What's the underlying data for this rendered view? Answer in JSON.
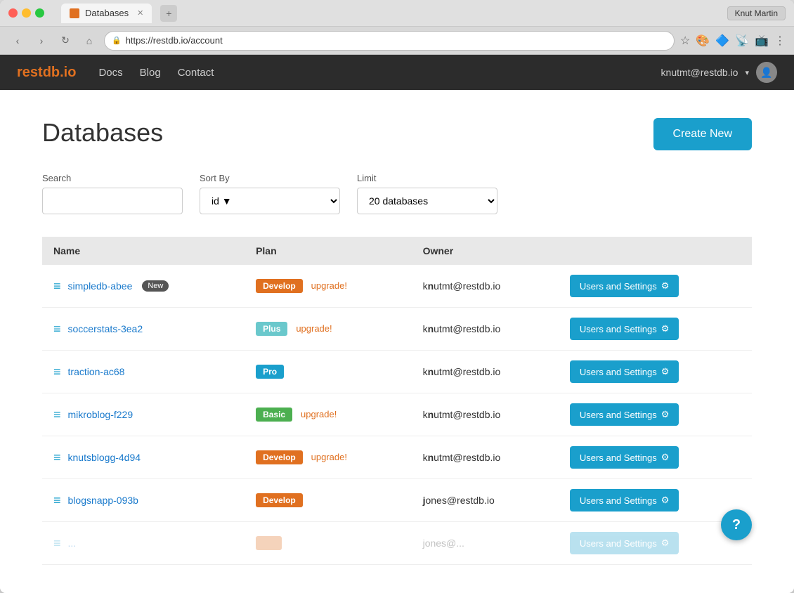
{
  "browser": {
    "tab_title": "Databases",
    "url": "https://restdb.io/account",
    "account_label": "Knut Martin",
    "nav_back": "‹",
    "nav_forward": "›",
    "nav_refresh": "↺",
    "nav_home": "⌂"
  },
  "app": {
    "logo": "restdb",
    "logo_suffix": ".io",
    "nav": {
      "docs": "Docs",
      "blog": "Blog",
      "contact": "Contact"
    },
    "user_email": "knutmt@restdb.io",
    "page_title": "Databases",
    "create_new_label": "Create New"
  },
  "filters": {
    "search_label": "Search",
    "search_placeholder": "",
    "sort_label": "Sort By",
    "sort_value": "id",
    "limit_label": "Limit",
    "limit_value": "20 databases"
  },
  "table": {
    "headers": [
      "Name",
      "Plan",
      "Owner",
      ""
    ],
    "rows": [
      {
        "name": "simpledb-abee",
        "is_new": true,
        "plan": "Develop",
        "plan_class": "plan-develop",
        "show_upgrade": true,
        "upgrade_label": "upgrade!",
        "owner": "knutmt@restdb.io",
        "owner_bold_char": "n",
        "settings_label": "Users and Settings",
        "settings_icon": "⚙"
      },
      {
        "name": "soccerstats-3ea2",
        "is_new": false,
        "plan": "Plus",
        "plan_class": "plan-plus",
        "show_upgrade": true,
        "upgrade_label": "upgrade!",
        "owner": "knutmt@restdb.io",
        "owner_bold_char": "n",
        "settings_label": "Users and Settings",
        "settings_icon": "⚙"
      },
      {
        "name": "traction-ac68",
        "is_new": false,
        "plan": "Pro",
        "plan_class": "plan-pro",
        "show_upgrade": false,
        "upgrade_label": "",
        "owner": "knutmt@restdb.io",
        "owner_bold_char": "n",
        "settings_label": "Users and Settings",
        "settings_icon": "⚙"
      },
      {
        "name": "mikroblog-f229",
        "is_new": false,
        "plan": "Basic",
        "plan_class": "plan-basic",
        "show_upgrade": true,
        "upgrade_label": "upgrade!",
        "owner": "knutmt@restdb.io",
        "owner_bold_char": "n",
        "settings_label": "Users and Settings",
        "settings_icon": "⚙"
      },
      {
        "name": "knutsblogg-4d94",
        "is_new": false,
        "plan": "Develop",
        "plan_class": "plan-develop",
        "show_upgrade": true,
        "upgrade_label": "upgrade!",
        "owner": "knutmt@restdb.io",
        "owner_bold_char": "n",
        "settings_label": "Users and Settings",
        "settings_icon": "⚙"
      },
      {
        "name": "blogsnapp-093b",
        "is_new": false,
        "plan": "Develop",
        "plan_class": "plan-develop",
        "show_upgrade": false,
        "upgrade_label": "",
        "owner": "jones@restdb.io",
        "owner_bold_char": "j",
        "settings_label": "Users and Settings",
        "settings_icon": "⚙"
      },
      {
        "name": "...",
        "is_new": false,
        "plan": "",
        "plan_class": "",
        "show_upgrade": false,
        "upgrade_label": "",
        "owner": "jones@...",
        "owner_bold_char": "",
        "settings_label": "Users and Settings",
        "settings_icon": "⚙"
      }
    ]
  },
  "help": {
    "label": "?"
  }
}
